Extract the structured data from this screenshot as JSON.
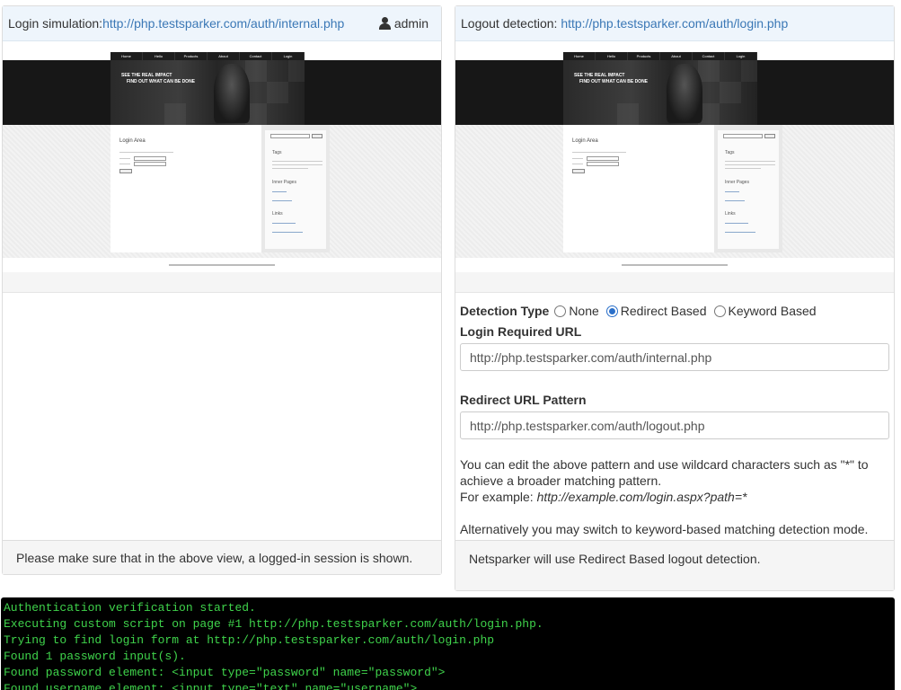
{
  "left_panel": {
    "heading_prefix": "Login simulation:",
    "heading_url": "http://php.testsparker.com/auth/internal.php",
    "user": "admin",
    "footer_text": "Please make sure that in the above view, a logged-in session is shown."
  },
  "right_panel": {
    "heading_prefix": "Logout detection: ",
    "heading_url": "http://php.testsparker.com/auth/login.php",
    "detection_type_label": "Detection Type",
    "radio_none": "None",
    "radio_redirect": "Redirect Based",
    "radio_keyword": "Keyword Based",
    "selected_detection": "Redirect Based",
    "login_required_url_label": "Login Required URL",
    "login_required_url_value": "http://php.testsparker.com/auth/internal.php",
    "redirect_pattern_label": "Redirect URL Pattern",
    "redirect_pattern_value": "http://php.testsparker.com/auth/logout.php",
    "help_line1": "You can edit the above pattern and use wildcard characters such as \"*\" to achieve a broader matching pattern.",
    "help_example_prefix": "For example: ",
    "help_example": "http://example.com/login.aspx?path=*",
    "help_alt": "Alternatively you may switch to keyword-based matching detection mode.",
    "footer_text": "Netsparker will use Redirect Based logout detection."
  },
  "preview_site": {
    "nav_left": [
      "Home",
      "Hello",
      "Products",
      "About",
      "Contact",
      "Login"
    ],
    "nav_right": [
      "Home",
      "Hello",
      "Products",
      "About",
      "Contact",
      "Login"
    ],
    "hero_line1": "SEE THE REAL IMPACT",
    "hero_line2": "FIND OUT WHAT CAN BE DONE",
    "content_title": "Login Area",
    "sidebar_tags": "Tags",
    "sidebar_pages": "Inner Pages",
    "sidebar_links": "Links"
  },
  "console": {
    "lines": [
      "Authentication verification started.",
      "Executing custom script on page #1 http://php.testsparker.com/auth/login.php.",
      "Trying to find login form at http://php.testsparker.com/auth/login.php",
      "Found 1 password input(s).",
      "Found password element: <input type=\"password\" name=\"password\">",
      "Found username element: <input type=\"text\" name=\"username\">"
    ]
  }
}
